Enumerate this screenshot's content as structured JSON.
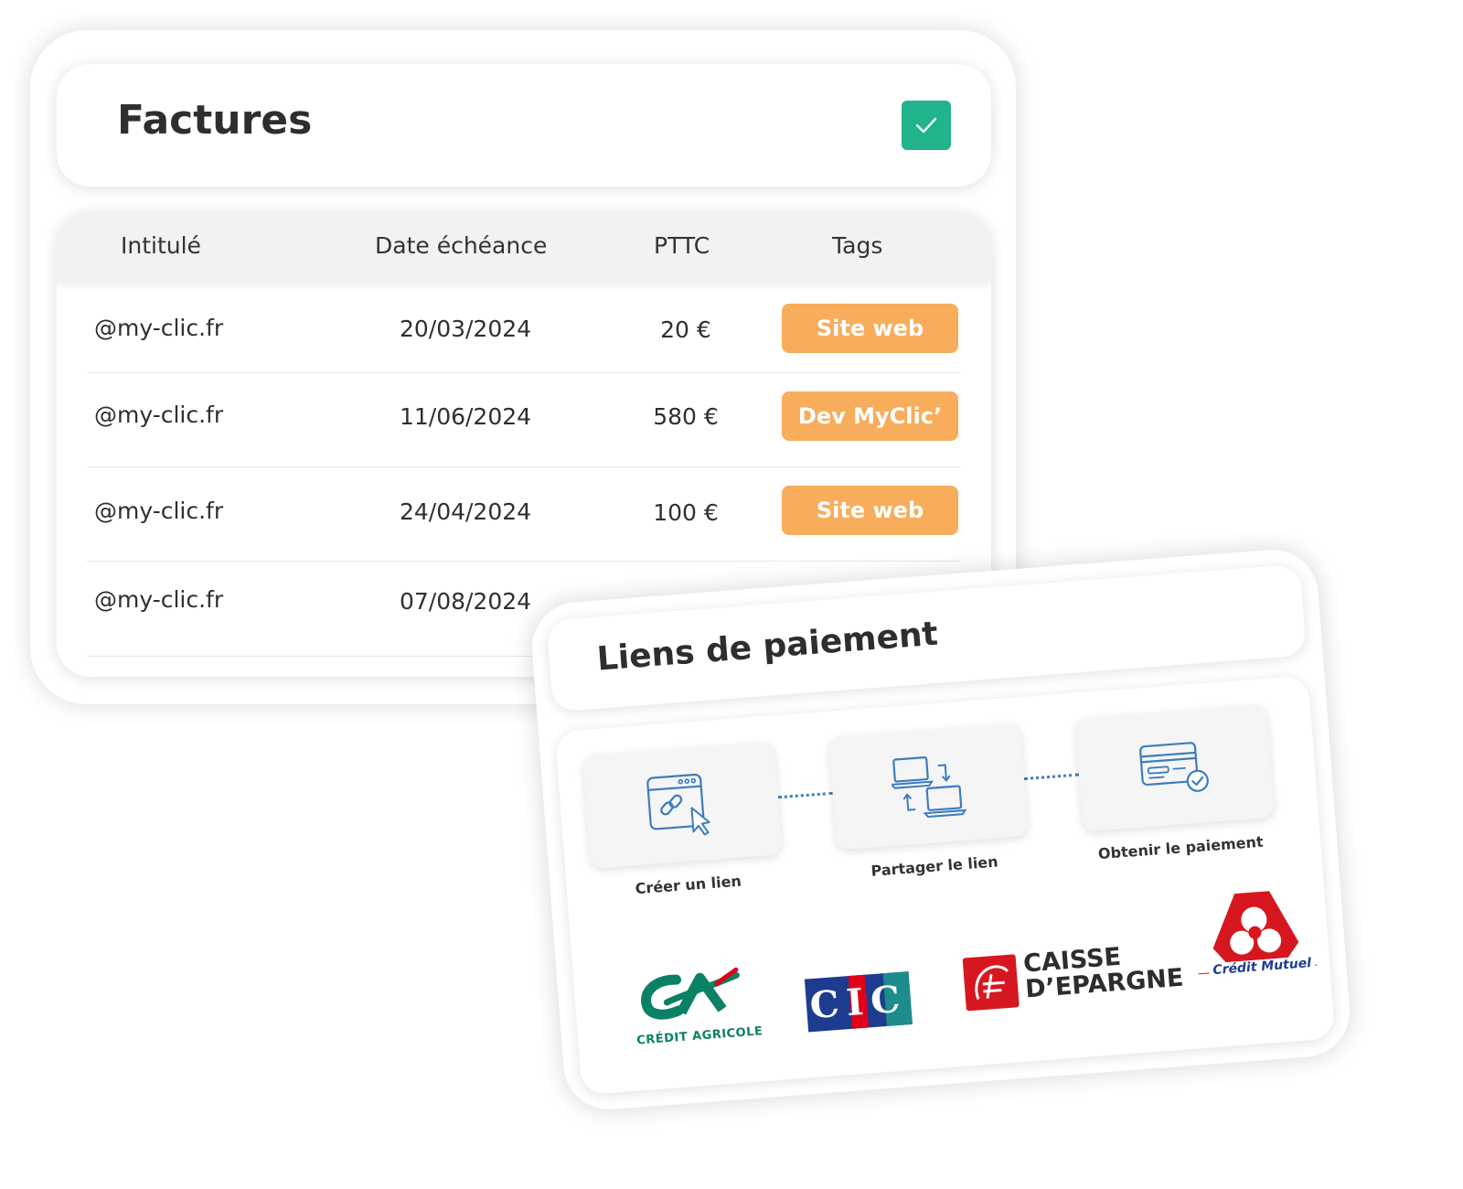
{
  "factures": {
    "title": "Factures",
    "columns": [
      "Intitulé",
      "Date échéance",
      "PTTC",
      "Tags"
    ],
    "rows": [
      {
        "name": "@my-clic.fr",
        "date": "20/03/2024",
        "price": "20 €",
        "tag": "Site web"
      },
      {
        "name": "@my-clic.fr",
        "date": "11/06/2024",
        "price": "580 €",
        "tag": "Dev MyClic’"
      },
      {
        "name": "@my-clic.fr",
        "date": "24/04/2024",
        "price": "100 €",
        "tag": "Site web"
      },
      {
        "name": "@my-clic.fr",
        "date": "07/08/2024",
        "price": "",
        "tag": ""
      }
    ]
  },
  "liens": {
    "title": "Liens de paiement",
    "steps": [
      {
        "label": "Créer un lien",
        "icon": "browser-link-cursor-icon"
      },
      {
        "label": "Partager le lien",
        "icon": "computers-exchange-icon"
      },
      {
        "label": "Obtenir le paiement",
        "icon": "credit-card-check-icon"
      }
    ],
    "banks": {
      "credit_agricole": "CRÉDIT AGRICOLE",
      "cic": "CIC",
      "caisse_line1": "CAISSE",
      "caisse_line2": "D’EPARGNE",
      "credit_mutuel": "Crédit Mutuel"
    }
  },
  "colors": {
    "accent_green": "#20b38c",
    "tag_orange": "#f7ad5b",
    "icon_blue": "#3d7cbf"
  }
}
